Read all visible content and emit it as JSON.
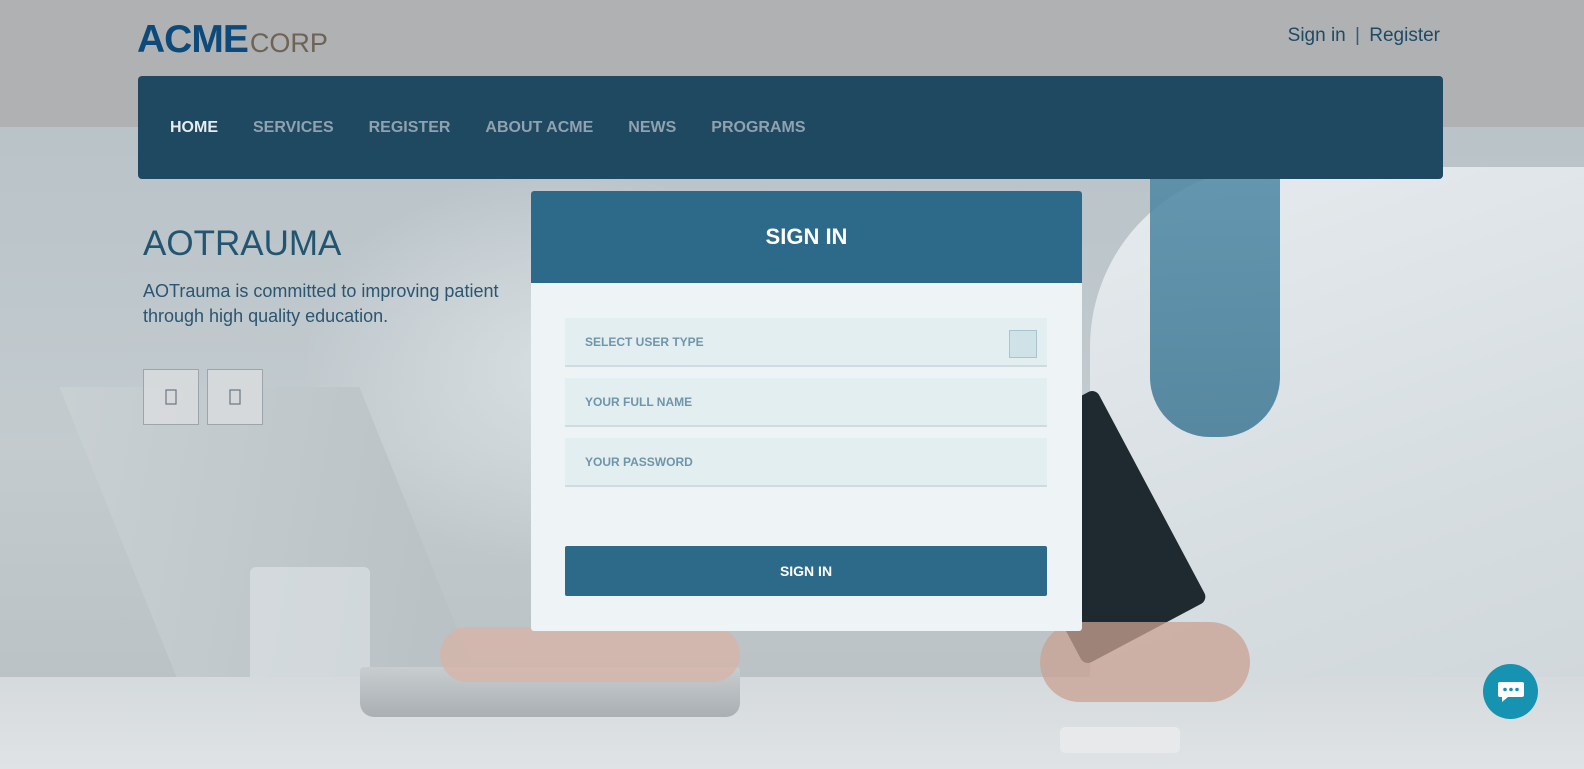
{
  "header": {
    "logo": {
      "primary": "ACME",
      "secondary": "CORP",
      "primary_color": "#0d4a7a",
      "secondary_color": "#6e6354"
    },
    "auth": {
      "sign_in": "Sign in",
      "separator": "|",
      "register": "Register"
    }
  },
  "nav": {
    "items": [
      {
        "label": "HOME",
        "active": true
      },
      {
        "label": "SERVICES",
        "active": false
      },
      {
        "label": "REGISTER",
        "active": false
      },
      {
        "label": "ABOUT ACME",
        "active": false
      },
      {
        "label": "NEWS",
        "active": false
      },
      {
        "label": "PROGRAMS",
        "active": false
      }
    ],
    "background": "#1e4961"
  },
  "hero": {
    "title": "AOTRAUMA",
    "description_line1": "AOTrauma is committed to improving patient",
    "description_line2": "through high quality education.",
    "prev_icon": "chevron-left-icon",
    "next_icon": "chevron-right-icon"
  },
  "signin": {
    "title": "SIGN IN",
    "user_type_placeholder": "SELECT USER TYPE",
    "full_name_placeholder": "YOUR FULL NAME",
    "password_placeholder": "YOUR PASSWORD",
    "submit_label": "SIGN IN",
    "accent": "#2d6a8a"
  },
  "chat": {
    "icon": "chat-bubble-icon",
    "color": "#1593b0"
  }
}
